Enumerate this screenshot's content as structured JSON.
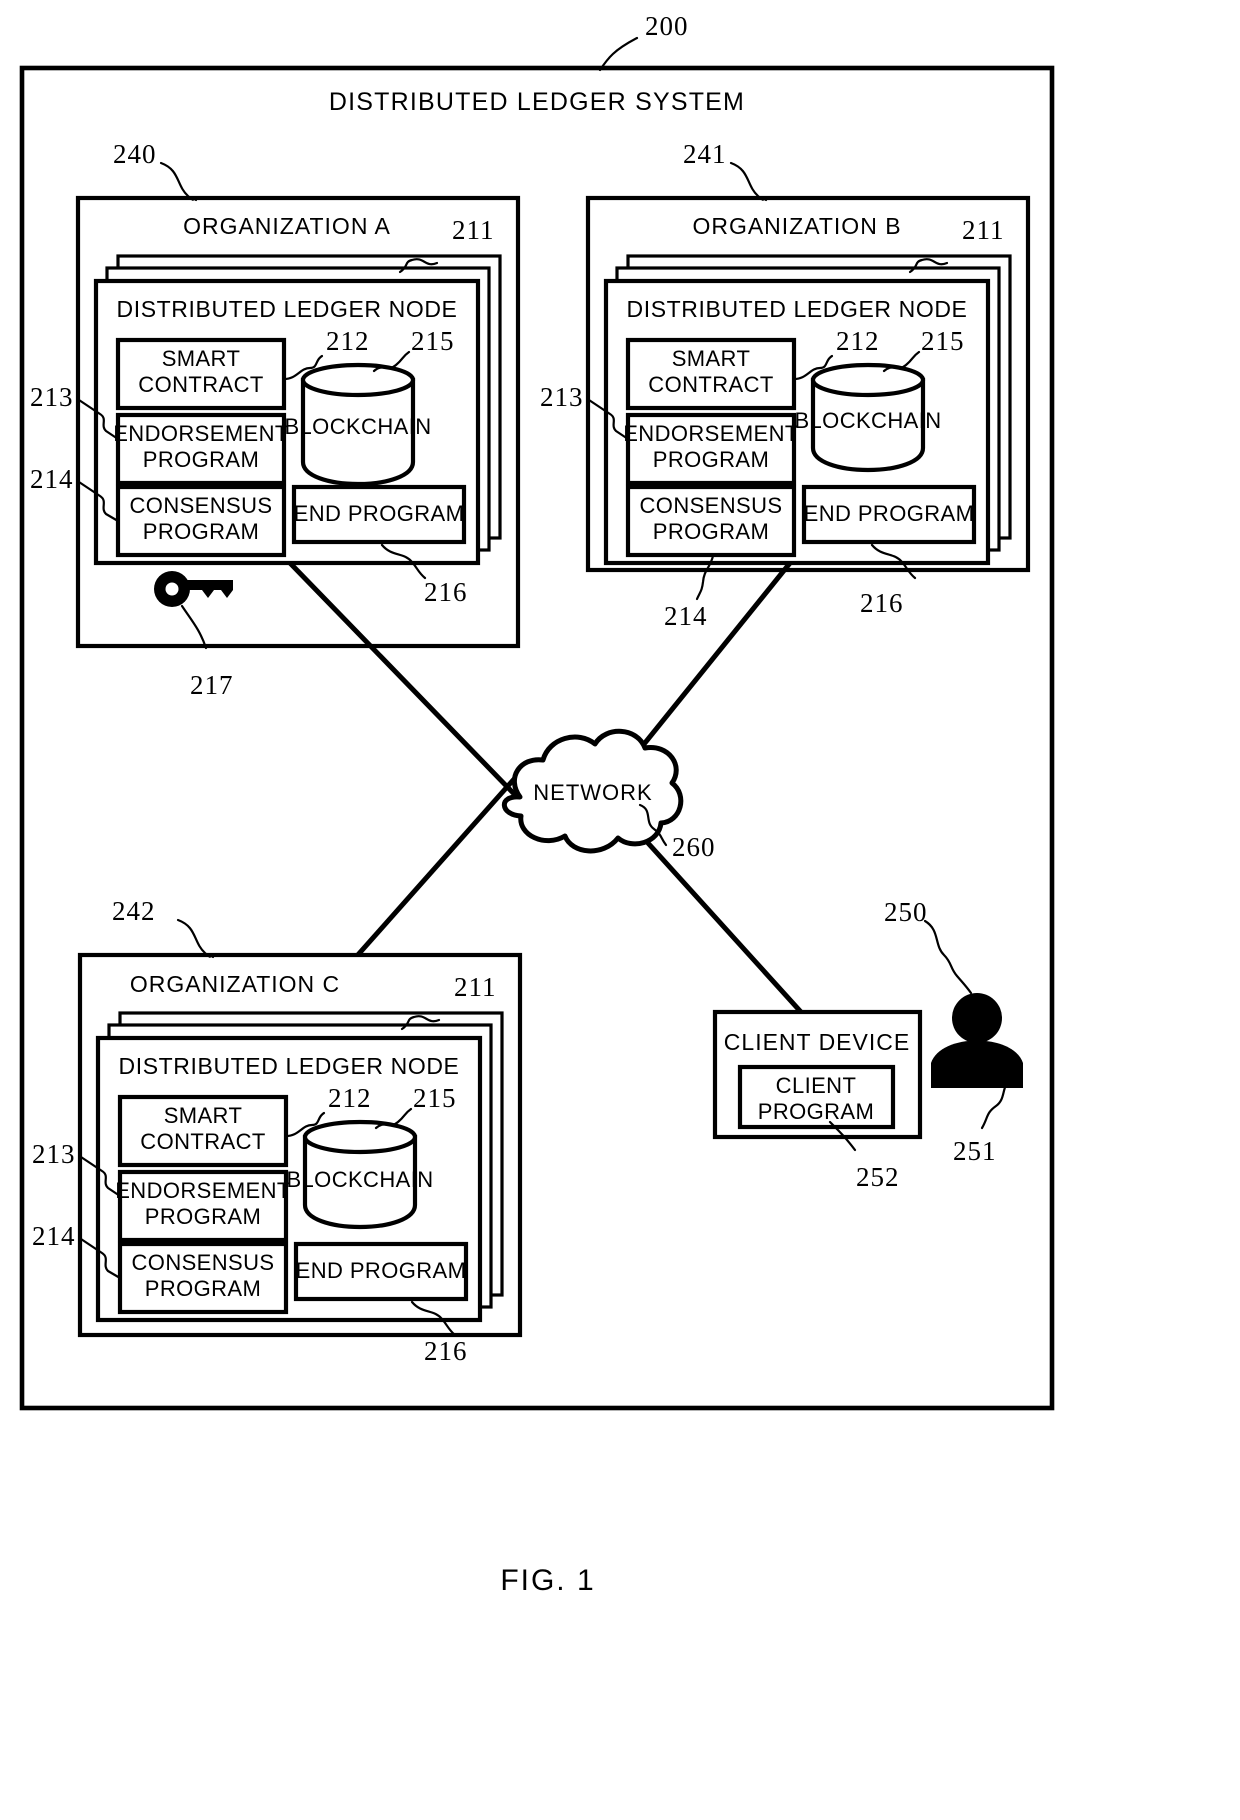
{
  "figure": {
    "caption": "FIG. 1",
    "system_ref": "200",
    "system_title": "DISTRIBUTED LEDGER SYSTEM"
  },
  "organizations": [
    {
      "id": "org-a",
      "ref": "240",
      "title": "ORGANIZATION A",
      "node": {
        "ref": "211",
        "title": "DISTRIBUTED LEDGER NODE",
        "components": [
          {
            "name": "smart-contract",
            "ref": "212",
            "label_line1": "SMART",
            "label_line2": "CONTRACT"
          },
          {
            "name": "endorsement-program",
            "ref": "213",
            "label_line1": "ENDORSEMENT",
            "label_line2": "PROGRAM"
          },
          {
            "name": "consensus-program",
            "ref": "214",
            "label_line1": "CONSENSUS",
            "label_line2": "PROGRAM"
          },
          {
            "name": "end-program",
            "ref": "216",
            "label_line1": "END PROGRAM",
            "label_line2": ""
          }
        ],
        "database": {
          "name": "blockchain",
          "ref": "215",
          "label": "BLOCKCHAIN"
        }
      },
      "key": {
        "ref": "217",
        "icon": "key-icon"
      }
    },
    {
      "id": "org-b",
      "ref": "241",
      "title": "ORGANIZATION B",
      "node": {
        "ref": "211",
        "title": "DISTRIBUTED LEDGER NODE",
        "components": [
          {
            "name": "smart-contract",
            "ref": "212",
            "label_line1": "SMART",
            "label_line2": "CONTRACT"
          },
          {
            "name": "endorsement-program",
            "ref": "213",
            "label_line1": "ENDORSEMENT",
            "label_line2": "PROGRAM"
          },
          {
            "name": "consensus-program",
            "ref": "214",
            "label_line1": "CONSENSUS",
            "label_line2": "PROGRAM"
          },
          {
            "name": "end-program",
            "ref": "216",
            "label_line1": "END PROGRAM",
            "label_line2": ""
          }
        ],
        "database": {
          "name": "blockchain",
          "ref": "215",
          "label": "BLOCKCHAIN"
        }
      }
    },
    {
      "id": "org-c",
      "ref": "242",
      "title": "ORGANIZATION C",
      "node": {
        "ref": "211",
        "title": "DISTRIBUTED LEDGER NODE",
        "components": [
          {
            "name": "smart-contract",
            "ref": "212",
            "label_line1": "SMART",
            "label_line2": "CONTRACT"
          },
          {
            "name": "endorsement-program",
            "ref": "213",
            "label_line1": "ENDORSEMENT",
            "label_line2": "PROGRAM"
          },
          {
            "name": "consensus-program",
            "ref": "214",
            "label_line1": "CONSENSUS",
            "label_line2": "PROGRAM"
          },
          {
            "name": "end-program",
            "ref": "216",
            "label_line1": "END PROGRAM",
            "label_line2": ""
          }
        ],
        "database": {
          "name": "blockchain",
          "ref": "215",
          "label": "BLOCKCHAIN"
        }
      }
    }
  ],
  "network": {
    "ref": "260",
    "label": "NETWORK",
    "icon": "cloud-icon"
  },
  "client": {
    "ref": "250",
    "title": "CLIENT DEVICE",
    "program": {
      "ref": "252",
      "label_line1": "CLIENT",
      "label_line2": "PROGRAM"
    },
    "user": {
      "ref": "251",
      "icon": "person-icon"
    }
  },
  "colors": {
    "line": "#000000",
    "background": "#ffffff"
  }
}
